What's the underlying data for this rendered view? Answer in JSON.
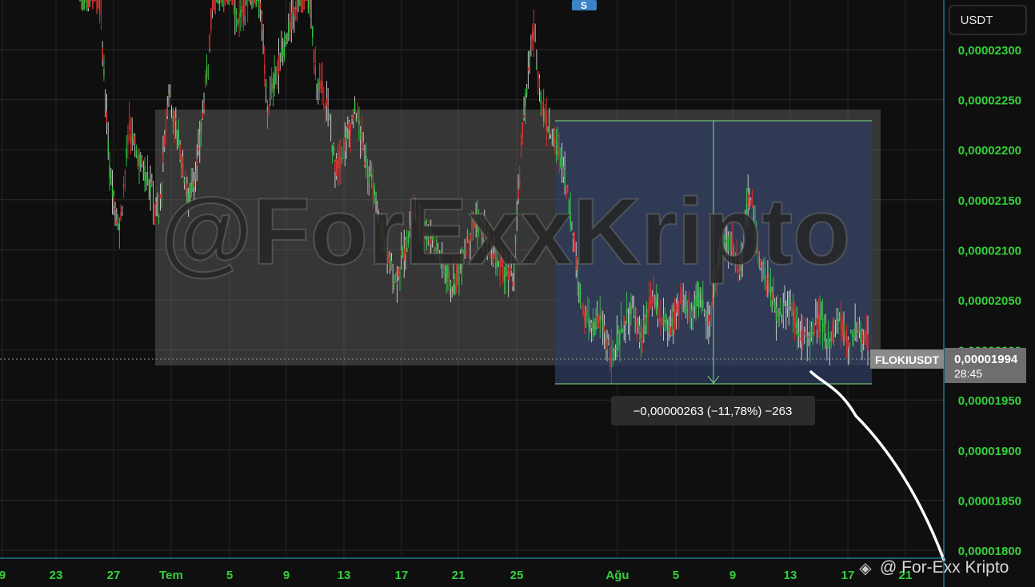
{
  "chart_data": {
    "type": "candlestick",
    "symbol": "FLOKIUSDT",
    "quote_currency": "USDT",
    "last_price": "0,00001994",
    "countdown": "28:45",
    "measure_label": "−0,00000263 (−11,78%) −263",
    "event_marker": "S",
    "watermark": "@ForExxKripto",
    "footer_brand": "@ For-Exx Kripto",
    "y_ticks": [
      {
        "label": "0,00002300",
        "value": 2.3e-05
      },
      {
        "label": "0,00002250",
        "value": 2.25e-05
      },
      {
        "label": "0,00002200",
        "value": 2.2e-05
      },
      {
        "label": "0,00002150",
        "value": 2.15e-05
      },
      {
        "label": "0,00002100",
        "value": 2.1e-05
      },
      {
        "label": "0,00002050",
        "value": 2.05e-05
      },
      {
        "label": "0,00002000",
        "value": 2e-05
      },
      {
        "label": "0,00001950",
        "value": 1.95e-05
      },
      {
        "label": "0,00001900",
        "value": 1.9e-05
      },
      {
        "label": "0,00001850",
        "value": 1.85e-05
      },
      {
        "label": "0,00001800",
        "value": 1.8e-05
      }
    ],
    "x_ticks": [
      "9",
      "23",
      "27",
      "Tem",
      "5",
      "9",
      "13",
      "17",
      "21",
      "25",
      "Ağu",
      "5",
      "9",
      "13",
      "17",
      "21"
    ],
    "grid": true,
    "price_path": [
      [
        2.5e-05,
        2.34e-05
      ],
      [
        2.5e-05,
        2.35e-05
      ],
      [
        2.35e-05,
        2.18e-05
      ],
      [
        2.18e-05,
        2.12e-05
      ],
      [
        2.12e-05,
        2.22e-05
      ],
      [
        2.22e-05,
        2.19e-05
      ],
      [
        2.19e-05,
        2.17e-05
      ],
      [
        2.17e-05,
        2.13e-05
      ],
      [
        2.13e-05,
        2.26e-05
      ],
      [
        2.26e-05,
        2.21e-05
      ],
      [
        2.21e-05,
        2.15e-05
      ],
      [
        2.15e-05,
        2.19e-05
      ],
      [
        2.19e-05,
        2.29e-05
      ],
      [
        2.29e-05,
        2.42e-05
      ],
      [
        2.42e-05,
        2.38e-05
      ],
      [
        2.38e-05,
        2.33e-05
      ],
      [
        2.33e-05,
        2.35e-05
      ],
      [
        2.35e-05,
        2.4e-05
      ],
      [
        2.4e-05,
        2.24e-05
      ],
      [
        2.24e-05,
        2.28e-05
      ],
      [
        2.28e-05,
        2.31e-05
      ],
      [
        2.31e-05,
        2.35e-05
      ],
      [
        2.35e-05,
        2.38e-05
      ],
      [
        2.38e-05,
        2.27e-05
      ],
      [
        2.27e-05,
        2.25e-05
      ],
      [
        2.25e-05,
        2.18e-05
      ],
      [
        2.18e-05,
        2.21e-05
      ],
      [
        2.21e-05,
        2.24e-05
      ],
      [
        2.24e-05,
        2.19e-05
      ],
      [
        2.19e-05,
        2.15e-05
      ],
      [
        2.15e-05,
        2.1e-05
      ],
      [
        2.1e-05,
        2.07e-05
      ],
      [
        2.07e-05,
        2.1e-05
      ],
      [
        2.1e-05,
        2.14e-05
      ],
      [
        2.14e-05,
        2.12e-05
      ],
      [
        2.12e-05,
        2.11e-05
      ],
      [
        2.11e-05,
        2.08e-05
      ],
      [
        2.08e-05,
        2.06e-05
      ],
      [
        2.06e-05,
        2.1e-05
      ],
      [
        2.1e-05,
        2.13e-05
      ],
      [
        2.13e-05,
        2.12e-05
      ],
      [
        2.12e-05,
        2.09e-05
      ],
      [
        2.09e-05,
        2.08e-05
      ],
      [
        2.08e-05,
        2.07e-05
      ],
      [
        2.07e-05,
        2.23e-05
      ],
      [
        2.23e-05,
        2.32e-05
      ],
      [
        2.32e-05,
        2.24e-05
      ],
      [
        2.24e-05,
        2.21e-05
      ],
      [
        2.21e-05,
        2.19e-05
      ],
      [
        2.19e-05,
        2.12e-05
      ],
      [
        2.12e-05,
        2.04e-05
      ],
      [
        2.04e-05,
        2.02e-05
      ],
      [
        2.02e-05,
        2.03e-05
      ],
      [
        2.03e-05,
        1.99e-05
      ],
      [
        1.99e-05,
        2.02e-05
      ],
      [
        2.02e-05,
        2.04e-05
      ],
      [
        2.04e-05,
        2.01e-05
      ],
      [
        2.01e-05,
        2.05e-05
      ],
      [
        2.05e-05,
        2.03e-05
      ],
      [
        2.03e-05,
        2.02e-05
      ],
      [
        2.02e-05,
        2.05e-05
      ],
      [
        2.05e-05,
        2.04e-05
      ],
      [
        2.04e-05,
        2.05e-05
      ],
      [
        2.05e-05,
        2.03e-05
      ],
      [
        2.03e-05,
        2.1e-05
      ],
      [
        2.1e-05,
        2.11e-05
      ],
      [
        2.11e-05,
        2.08e-05
      ],
      [
        2.08e-05,
        2.16e-05
      ],
      [
        2.16e-05,
        2.09e-05
      ],
      [
        2.09e-05,
        2.06e-05
      ],
      [
        2.06e-05,
        2.03e-05
      ],
      [
        2.03e-05,
        2.05e-05
      ],
      [
        2.05e-05,
        2.02e-05
      ],
      [
        2.02e-05,
        2.01e-05
      ],
      [
        2.01e-05,
        2.03e-05
      ],
      [
        2.03e-05,
        2.01e-05
      ],
      [
        2.01e-05,
        2.03e-05
      ],
      [
        2.03e-05,
        2.01e-05
      ],
      [
        2.01e-05,
        2.02e-05
      ],
      [
        2.02e-05,
        2.01e-05
      ],
      [
        2.01e-05,
        1.94e-05
      ]
    ]
  }
}
